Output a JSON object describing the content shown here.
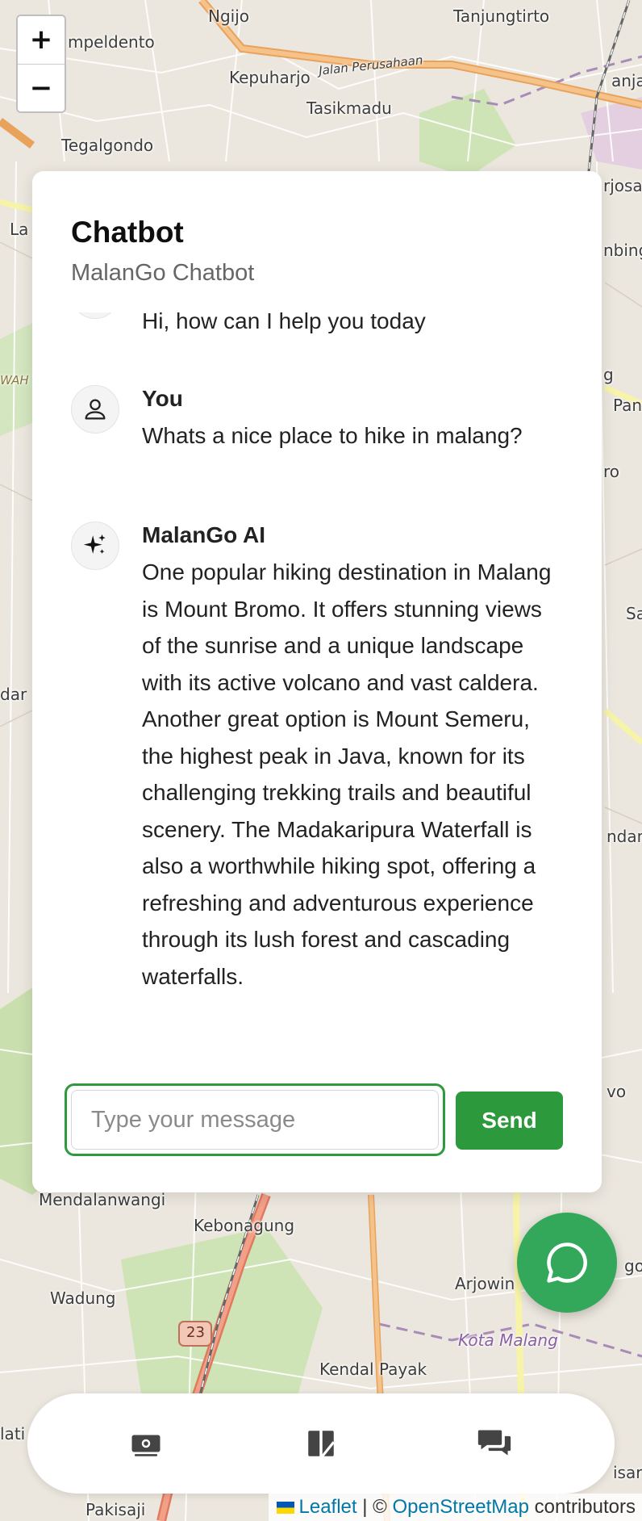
{
  "map": {
    "labels": [
      "Ngijo",
      "Tanjungtirto",
      "mpeldento",
      "Kepuharjo",
      "Jalan Perusahaan",
      "Tasikmadu",
      "anja",
      "Tegalgondo",
      "rjosa",
      "La",
      "nbing",
      "g",
      "Pan",
      "WAH",
      "ro",
      "Sa",
      "dar",
      "ndan",
      "vo",
      "Mendalanwangi",
      "Kebonagung",
      "Wadung",
      "Arjowin",
      "go",
      "23",
      "Kota Malang",
      "Kendal Payak",
      "lati",
      "isari",
      "Pakisaji"
    ]
  },
  "zoom": {
    "in_label": "+",
    "out_label": "−"
  },
  "chat": {
    "title": "Chatbot",
    "subtitle": "MalanGo Chatbot",
    "messages": [
      {
        "sender": "",
        "text": "Hi, how can I help you today",
        "avatar": "sparkle-icon"
      },
      {
        "sender": "You",
        "text": "Whats a nice place to hike in malang?",
        "avatar": "user-icon"
      },
      {
        "sender": "MalanGo AI",
        "text": "One popular hiking destination in Malang is Mount Bromo. It offers stunning views of the sunrise and a unique landscape with its active volcano and vast caldera. Another great option is Mount Semeru, the highest peak in Java, known for its challenging trekking trails and beautiful scenery. The Madakaripura Waterfall is also a worthwhile hiking spot, offering a refreshing and adventurous experience through its lush forest and cascading waterfalls.",
        "avatar": "sparkle-icon"
      }
    ],
    "input": {
      "placeholder": "Type your message",
      "value": ""
    },
    "send_label": "Send"
  },
  "fab": {
    "icon": "chat-bubble-icon"
  },
  "bottom_nav": {
    "items": [
      {
        "icon": "money-icon"
      },
      {
        "icon": "map-book-icon"
      },
      {
        "icon": "chat-icon"
      }
    ]
  },
  "attribution": {
    "leaflet": "Leaflet",
    "separator": "|",
    "copyright": "©",
    "osm": "OpenStreetMap",
    "contributors": "contributors"
  },
  "colors": {
    "accent": "#2c9a3c",
    "fab": "#34a85a",
    "link": "#0078a8"
  }
}
